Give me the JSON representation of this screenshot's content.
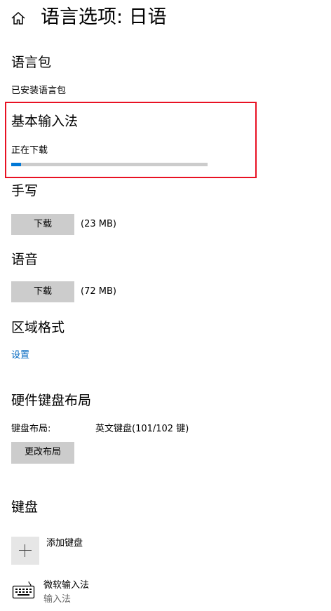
{
  "header": {
    "title": "语言选项: 日语"
  },
  "language_pack": {
    "heading": "语言包",
    "status": "已安装语言包"
  },
  "basic_typing": {
    "heading": "基本输入法",
    "status": "正在下载",
    "progress": 0.05
  },
  "handwriting": {
    "heading": "手写",
    "button": "下载",
    "size": "(23 MB)"
  },
  "speech": {
    "heading": "语音",
    "button": "下载",
    "size": "(72 MB)"
  },
  "regional_format": {
    "heading": "区域格式",
    "link": "设置"
  },
  "hardware_keyboard": {
    "heading": "硬件键盘布局",
    "label": "键盘布局:",
    "value": "英文键盘(101/102 键)",
    "button": "更改布局"
  },
  "keyboards": {
    "heading": "键盘",
    "add_label": "添加键盘",
    "items": [
      {
        "name": "微软输入法",
        "type": "输入法"
      }
    ]
  },
  "colors": {
    "accent": "#0078d7",
    "highlight": "#e81123",
    "button_bg": "#cccccc"
  },
  "icons": {
    "home": "home-icon",
    "add": "plus-icon",
    "keyboard": "keyboard-icon"
  }
}
